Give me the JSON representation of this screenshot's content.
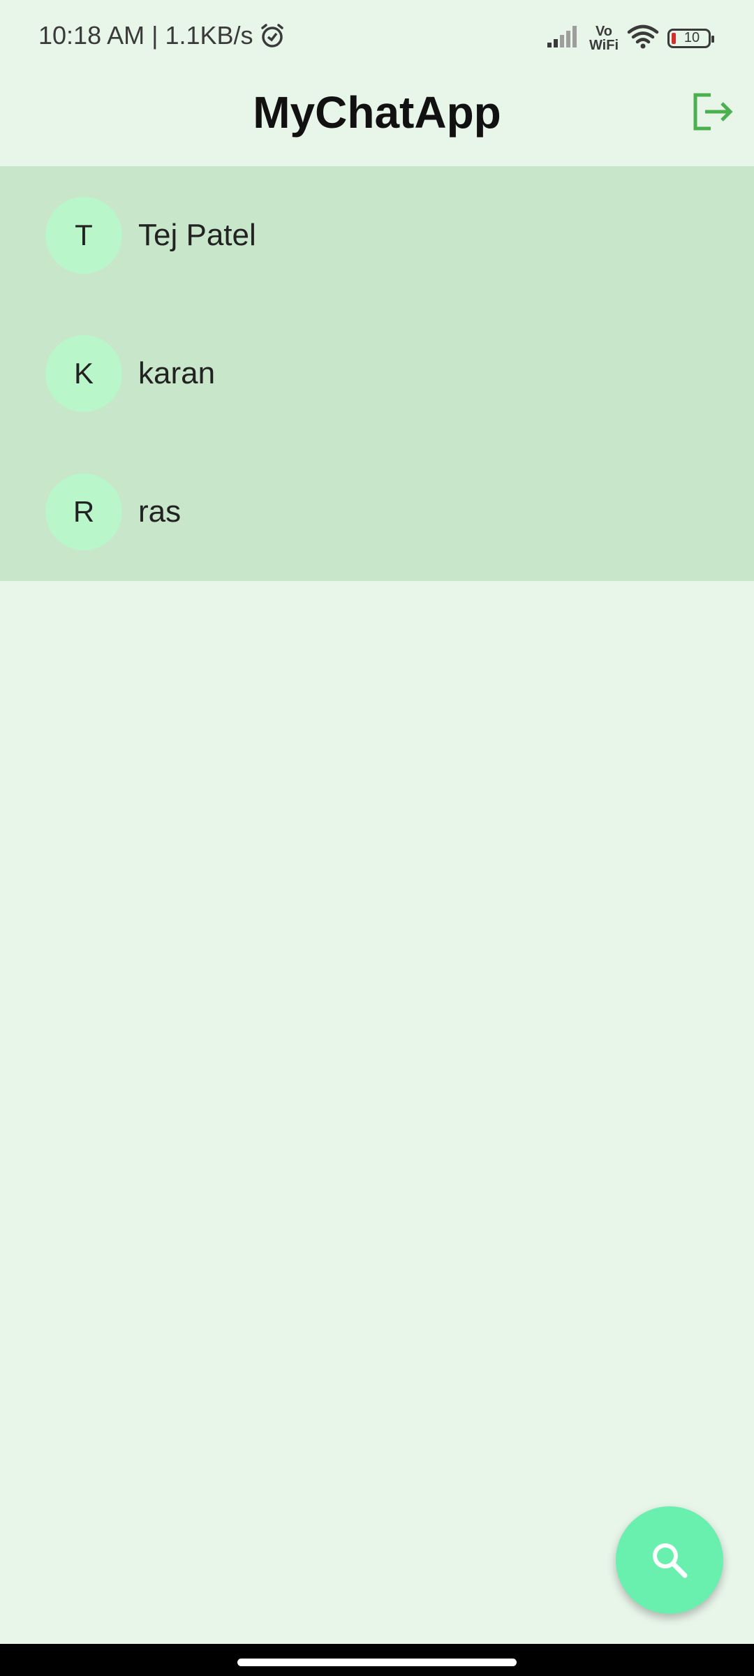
{
  "status_bar": {
    "time_speed": "10:18 AM | 1.1KB/s",
    "vowifi_top": "Vo",
    "vowifi_bottom": "WiFi",
    "battery_level": "10"
  },
  "app_bar": {
    "title": "MyChatApp",
    "logout_icon": "logout-icon"
  },
  "chats": [
    {
      "initial": "T",
      "name": "Tej Patel"
    },
    {
      "initial": "K",
      "name": "karan"
    },
    {
      "initial": "R",
      "name": "ras"
    }
  ],
  "fab": {
    "icon": "search-icon"
  },
  "colors": {
    "background": "#e8f5e9",
    "list_background": "#c8e6c9",
    "avatar": "#b9f6ca",
    "accent": "#4caf50",
    "fab": "#69f0ae"
  }
}
